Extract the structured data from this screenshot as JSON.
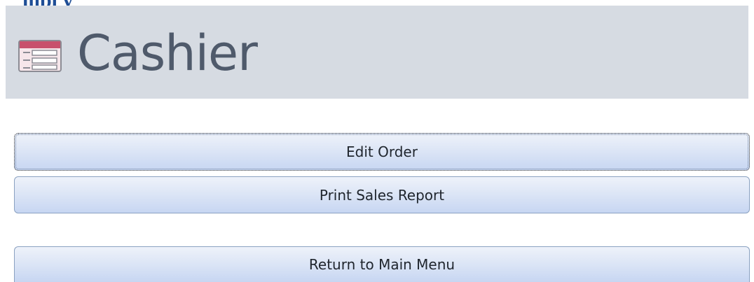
{
  "page_title_partial": "mpl y",
  "header": {
    "title": "Cashier",
    "icon": "form-icon"
  },
  "buttons": {
    "edit_order": "Edit Order",
    "print_sales_report": "Print Sales Report",
    "return_main_menu": "Return to Main Menu"
  },
  "colors": {
    "header_band": "#d6dbe2",
    "title_text": "#4f5a6b",
    "cut_title": "#1f4e96",
    "button_top": "#eef2fa",
    "button_bottom": "#c7d6f2",
    "button_border": "#8aa1c1"
  }
}
